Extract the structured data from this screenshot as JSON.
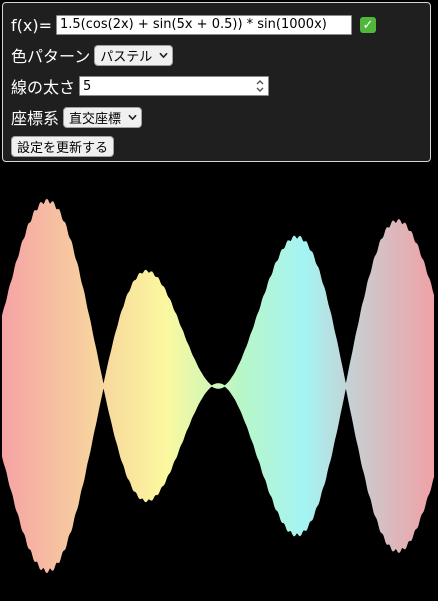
{
  "controls": {
    "function_label": "f(x)=",
    "function_value": "1.5(cos(2x) + sin(5x + 0.5)) * sin(1000x)",
    "valid_icon": "check-mark-icon",
    "color_label": "色パターン",
    "color_value": "パステル",
    "width_label": "線の太さ",
    "width_value": "5",
    "coord_label": "座標系",
    "coord_value": "直交座標",
    "update_button": "設定を更新する"
  },
  "plot": {
    "background": "#000000",
    "function": "1.5(cos(2x) + sin(5x + 0.5)) * sin(1000x)",
    "color_scheme": "pastel rainbow",
    "colors": [
      "#f4a0a6",
      "#f8d8a0",
      "#fbf7a0",
      "#b9f7c0",
      "#a6f4f0",
      "#d8d8d8",
      "#f0a0a8"
    ]
  }
}
